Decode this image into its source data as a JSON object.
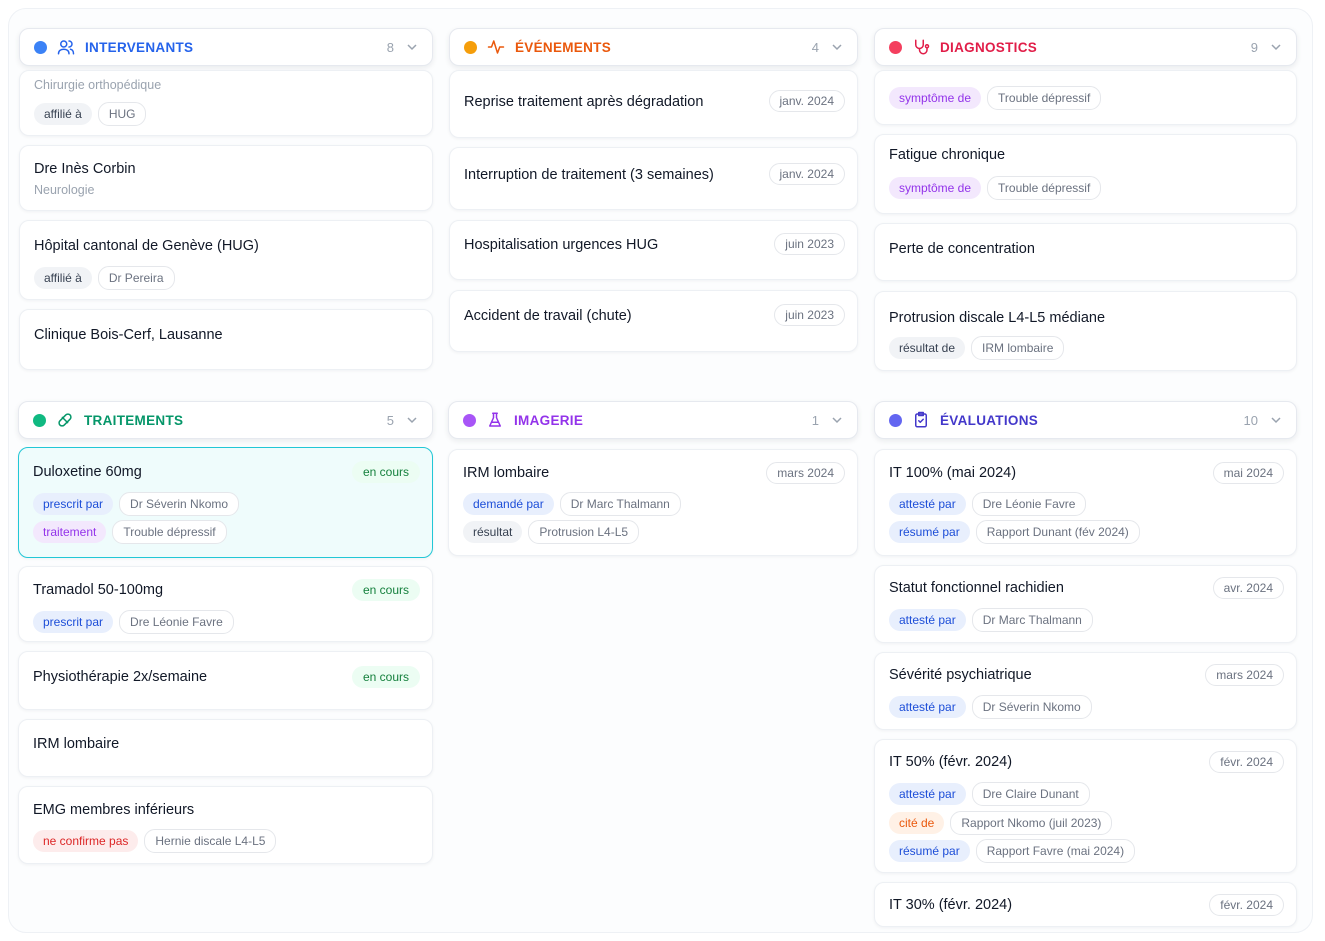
{
  "colors": {
    "intervenants": "#3b82f6",
    "evenements": "#f59e0b",
    "diagnostics": "#f43f5e",
    "traitements": "#10b981",
    "imagerie": "#a855f7",
    "evaluations": "#6366f1"
  },
  "sections": {
    "intervenants": {
      "title": "INTERVENANTS",
      "count": "8",
      "icon": "users-icon"
    },
    "evenements": {
      "title": "ÉVÉNEMENTS",
      "count": "4",
      "icon": "pulse-icon"
    },
    "diagnostics": {
      "title": "DIAGNOSTICS",
      "count": "9",
      "icon": "stethoscope-icon"
    },
    "traitements": {
      "title": "TRAITEMENTS",
      "count": "5",
      "icon": "pill-icon"
    },
    "imagerie": {
      "title": "IMAGERIE",
      "count": "1",
      "icon": "flask-icon"
    },
    "evaluations": {
      "title": "ÉVALUATIONS",
      "count": "10",
      "icon": "clipboard-icon"
    }
  },
  "intervenants": [
    {
      "subtitle": "Chirurgie orthopédique",
      "tags": [
        {
          "rel": "affilié à",
          "val": "HUG"
        }
      ]
    },
    {
      "title": "Dre Inès Corbin",
      "subtitle": "Neurologie"
    },
    {
      "title": "Hôpital cantonal de Genève (HUG)",
      "tags": [
        {
          "rel": "affilié à",
          "val": "Dr Pereira"
        }
      ]
    },
    {
      "title": "Clinique Bois-Cerf, Lausanne"
    }
  ],
  "evenements": [
    {
      "title": "Reprise traitement après dégradation",
      "date": "janv. 2024"
    },
    {
      "title": "Interruption de traitement (3 semaines)",
      "date": "janv. 2024"
    },
    {
      "title": "Hospitalisation urgences HUG",
      "date": "juin 2023"
    },
    {
      "title": "Accident de travail (chute)",
      "date": "juin 2023"
    }
  ],
  "diagnostics": [
    {
      "tags": [
        {
          "rel": "symptôme de",
          "val": "Trouble dépressif"
        }
      ]
    },
    {
      "title": "Fatigue chronique",
      "tags": [
        {
          "rel": "symptôme de",
          "val": "Trouble dépressif"
        }
      ]
    },
    {
      "title": "Perte de concentration"
    },
    {
      "title": "Protrusion discale L4-L5 médiane",
      "tags": [
        {
          "rel": "résultat de",
          "val": "IRM lombaire"
        }
      ]
    }
  ],
  "traitements": [
    {
      "title": "Duloxetine 60mg",
      "status": "en cours",
      "tags": [
        {
          "rel": "prescrit par",
          "val": "Dr Séverin Nkomo"
        },
        {
          "rel": "traitement",
          "val": "Trouble dépressif"
        }
      ]
    },
    {
      "title": "Tramadol 50-100mg",
      "status": "en cours",
      "tags": [
        {
          "rel": "prescrit par",
          "val": "Dre Léonie Favre"
        }
      ]
    },
    {
      "title": "Physiothérapie 2x/semaine",
      "status": "en cours"
    },
    {
      "title": "IRM lombaire"
    },
    {
      "title": "EMG membres inférieurs",
      "tags": [
        {
          "rel": "ne confirme pas",
          "val": "Hernie discale L4-L5"
        }
      ]
    }
  ],
  "imagerie": [
    {
      "title": "IRM lombaire",
      "date": "mars 2024",
      "tags": [
        {
          "rel": "demandé par",
          "val": "Dr Marc Thalmann"
        },
        {
          "rel": "résultat",
          "val": "Protrusion L4-L5"
        }
      ]
    }
  ],
  "evaluations": [
    {
      "title": "IT 100% (mai 2024)",
      "date": "mai 2024",
      "tags": [
        {
          "rel": "attesté par",
          "val": "Dre Léonie Favre"
        },
        {
          "rel": "résumé par",
          "val": "Rapport Dunant (fév 2024)"
        }
      ]
    },
    {
      "title": "Statut fonctionnel rachidien",
      "date": "avr. 2024",
      "tags": [
        {
          "rel": "attesté par",
          "val": "Dr Marc Thalmann"
        }
      ]
    },
    {
      "title": "Sévérité psychiatrique",
      "date": "mars 2024",
      "tags": [
        {
          "rel": "attesté par",
          "val": "Dr Séverin Nkomo"
        }
      ]
    },
    {
      "title": "IT 50% (févr. 2024)",
      "date": "févr. 2024",
      "tags": [
        {
          "rel": "attesté par",
          "val": "Dre Claire Dunant"
        },
        {
          "rel": "cité de",
          "val": "Rapport Nkomo (juil 2023)"
        },
        {
          "rel": "résumé par",
          "val": "Rapport Favre (mai 2024)"
        }
      ]
    },
    {
      "title": "IT 30% (févr. 2024)",
      "date": "févr. 2024"
    }
  ]
}
